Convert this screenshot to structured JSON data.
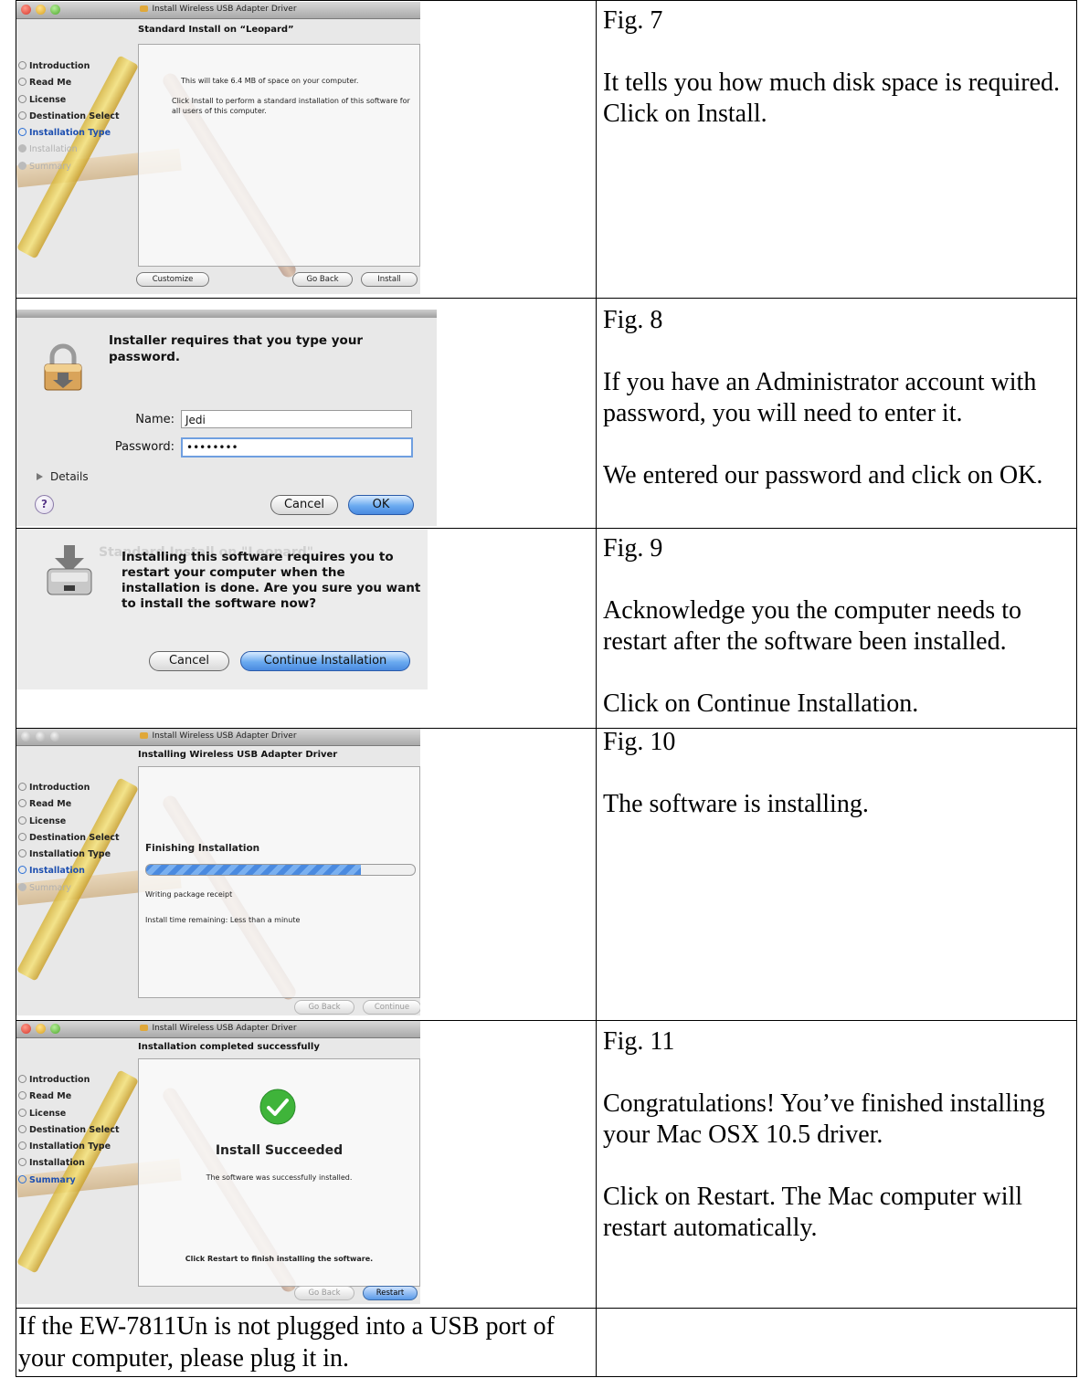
{
  "figures": [
    {
      "label": "Fig. 7",
      "paragraphs": [
        "It tells you how much disk space is required.  Click on Install."
      ]
    },
    {
      "label": "Fig. 8",
      "paragraphs": [
        "If you have an Administrator account with password, you will need to enter it.",
        "We entered our password and click on OK."
      ]
    },
    {
      "label": "Fig. 9",
      "paragraphs": [
        "Acknowledge you the computer needs to restart after the software been installed.",
        "Click on Continue Installation."
      ]
    },
    {
      "label": "Fig. 10",
      "paragraphs": [
        "The software is installing."
      ]
    },
    {
      "label": "Fig. 11",
      "paragraphs": [
        "Congratulations!  You’ve finished installing your Mac OSX 10.5 driver.",
        "Click on Restart.  The Mac computer will restart automatically."
      ]
    }
  ],
  "footer_text": "If the EW-7811Un is not plugged into a USB port of your computer, please plug it in.",
  "installer": {
    "window_title": "Install Wireless USB Adapter Driver",
    "steps": [
      "Introduction",
      "Read Me",
      "License",
      "Destination Select",
      "Installation Type",
      "Installation",
      "Summary"
    ],
    "fig7": {
      "heading": "Standard Install on “Leopard”",
      "space_text": "This will take 6.4 MB of space on your computer.",
      "install_text": "Click Install to perform a standard installation of this software for all users of this computer.",
      "customize": "Customize",
      "go_back": "Go Back",
      "install": "Install"
    },
    "fig10": {
      "heading": "Installing Wireless USB Adapter Driver",
      "phase": "Finishing Installation",
      "progress": 0.8,
      "status": "Writing package receipt",
      "time_remaining": "Install time remaining: Less than a minute",
      "go_back": "Go Back",
      "continue": "Continue"
    },
    "fig11": {
      "heading": "Installation completed successfully",
      "result": "Install Succeeded",
      "success_text": "The software was successfully installed.",
      "restart_hint": "Click Restart to finish installing the software.",
      "go_back": "Go Back",
      "restart": "Restart"
    }
  },
  "auth_dialog": {
    "message": "Installer requires that you type your password.",
    "name_label": "Name:",
    "name_value": "Jedi",
    "password_label": "Password:",
    "password_value": "••••••••",
    "details": "Details",
    "help": "?",
    "cancel": "Cancel",
    "ok": "OK"
  },
  "restart_sheet": {
    "message": "Installing this software requires you to restart your computer when the installation is done. Are you sure you want to install the software now?",
    "cancel": "Cancel",
    "continue": "Continue Installation"
  }
}
